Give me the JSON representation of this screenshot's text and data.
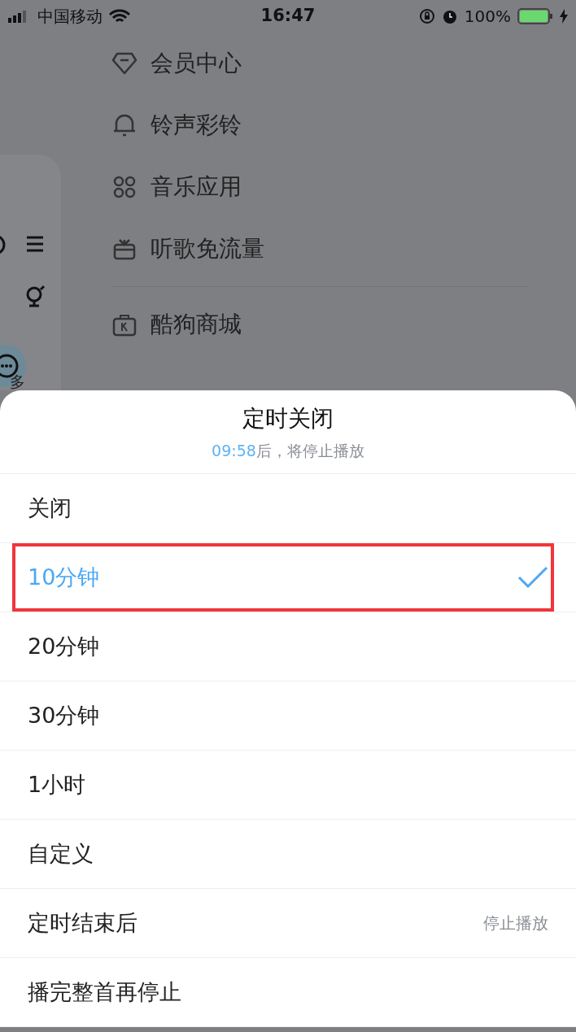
{
  "status_bar": {
    "carrier": "中国移动",
    "time": "16:47",
    "battery": "100%"
  },
  "drawer": {
    "sections": [
      {
        "items": [
          {
            "kind": "diamond",
            "label": "会员中心"
          },
          {
            "kind": "bell",
            "label": "铃声彩铃"
          },
          {
            "kind": "grid",
            "label": "音乐应用"
          },
          {
            "kind": "gift",
            "label": "听歌免流量"
          }
        ]
      },
      {
        "items": [
          {
            "kind": "bag",
            "label": "酷狗商城"
          }
        ]
      }
    ]
  },
  "side_panel": {
    "more_label": "多"
  },
  "sheet": {
    "title": "定时关闭",
    "countdown": "09:58",
    "subtitle": "后，将停止播放",
    "options": [
      {
        "kind": "choice",
        "label": "关闭",
        "selected": false,
        "annotated": false
      },
      {
        "kind": "choice",
        "label": "10分钟",
        "selected": true,
        "annotated": true
      },
      {
        "kind": "choice",
        "label": "20分钟",
        "selected": false,
        "annotated": false
      },
      {
        "kind": "choice",
        "label": "30分钟",
        "selected": false,
        "annotated": false
      },
      {
        "kind": "choice",
        "label": "1小时",
        "selected": false,
        "annotated": false
      },
      {
        "kind": "choice",
        "label": "自定义",
        "selected": false,
        "annotated": false
      },
      {
        "kind": "setting",
        "label": "定时结束后",
        "value": "停止播放"
      },
      {
        "kind": "setting",
        "label": "播完整首再停止"
      }
    ]
  }
}
